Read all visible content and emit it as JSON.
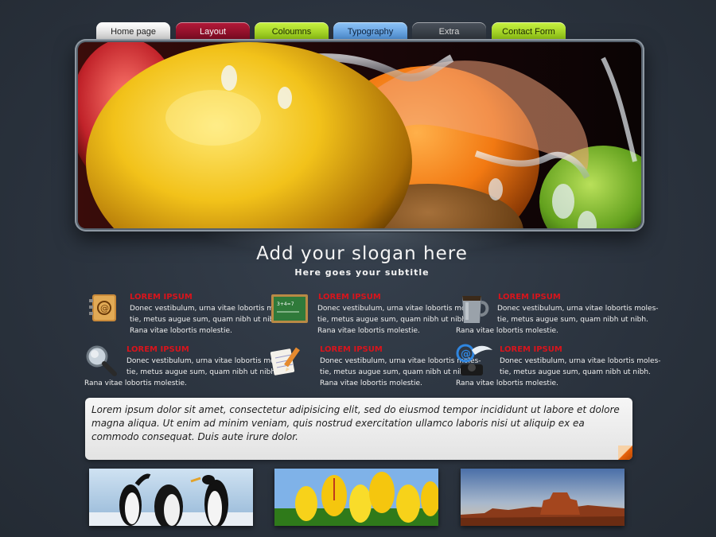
{
  "nav": {
    "tabs": [
      {
        "label": "Home page"
      },
      {
        "label": "Layout"
      },
      {
        "label": "Coloumns"
      },
      {
        "label": "Typography"
      },
      {
        "label": "Extra"
      },
      {
        "label": "Contact Form"
      }
    ]
  },
  "hero": {
    "slogan": "Add your slogan here",
    "subtitle": "Here goes your subtitle"
  },
  "features": [
    {
      "icon": "address-book-icon",
      "title": "LOREM IPSUM",
      "lines": [
        "Donec vestibulum, urna vitae lobortis moles-",
        "tie, metus augue sum, quam nibh ut nibh.",
        "Rana vitae lobortis molestie."
      ]
    },
    {
      "icon": "chalkboard-icon",
      "title": "LOREM IPSUM",
      "lines": [
        "Donec vestibulum, urna vitae lobortis moles-",
        "tie, metus augue sum, quam nibh ut nibh.",
        "Rana vitae lobortis molestie."
      ]
    },
    {
      "icon": "mug-icon",
      "title": "LOREM IPSUM",
      "lines": [
        "Donec vestibulum, urna vitae lobortis moles-",
        "tie, metus augue sum, quam nibh ut nibh.",
        "Rana vitae lobortis molestie."
      ]
    },
    {
      "icon": "magnifier-icon",
      "title": "LOREM IPSUM",
      "lines": [
        "Donec vestibulum, urna vitae lobortis moles-",
        "tie, metus augue sum, quam nibh ut nibh.",
        "Rana vitae lobortis molestie."
      ]
    },
    {
      "icon": "notepad-pencil-icon",
      "title": "LOREM IPSUM",
      "lines": [
        "Donec vestibulum, urna vitae lobortis moles-",
        "tie, metus augue sum, quam nibh ut nibh.",
        "Rana vitae lobortis molestie."
      ]
    },
    {
      "icon": "email-phone-icon",
      "title": "LOREM IPSUM",
      "lines": [
        "Donec vestibulum, urna vitae lobortis moles-",
        "tie, metus augue sum, quam nibh ut nibh.",
        "Rana vitae lobortis molestie."
      ]
    }
  ],
  "quote": {
    "text": "Lorem ipsum dolor sit amet, consectetur adipisicing elit, sed do eiusmod tempor incididunt ut labore et dolore magna aliqua. Ut enim ad minim veniam, quis nostrud exercitation ullamco laboris nisi ut aliquip ex ea commodo consequat. Duis aute irure dolor."
  },
  "thumbnails": [
    {
      "subject": "penguins"
    },
    {
      "subject": "yellow tulips"
    },
    {
      "subject": "desert mesa"
    }
  ],
  "colors": {
    "background": "#2b3440",
    "feature_title": "#d8141c",
    "tab_layout": "#9a1230",
    "tab_columns": "#aee02a",
    "tab_typography": "#6aa9ea"
  }
}
